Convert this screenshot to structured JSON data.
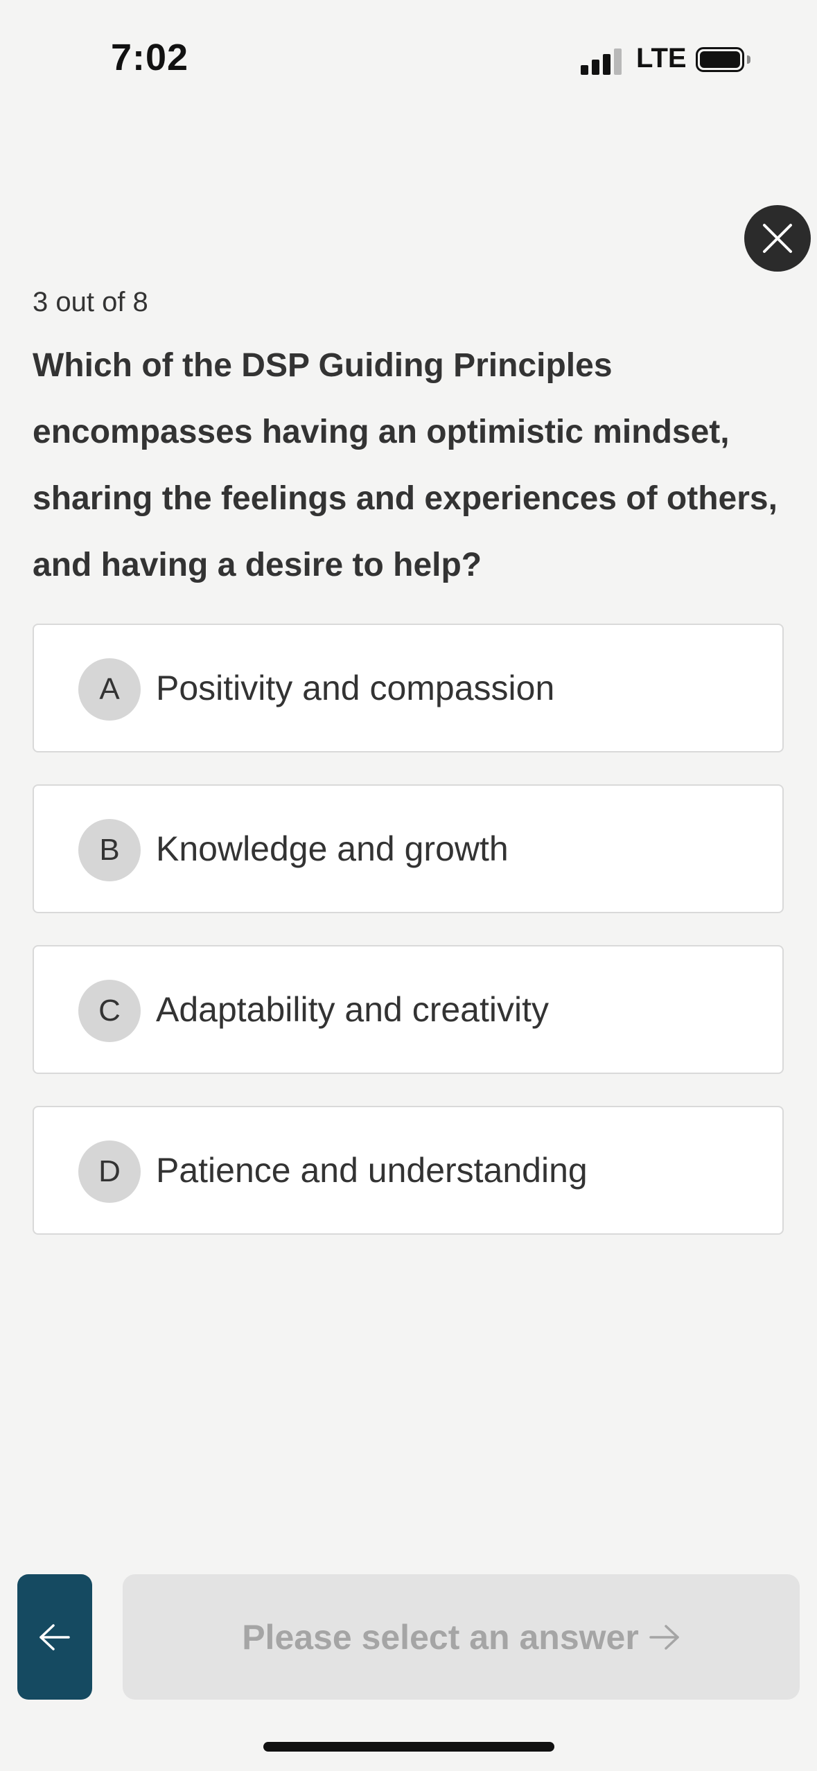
{
  "status_bar": {
    "time": "7:02",
    "network": "LTE",
    "signal_icon": "cellular-signal-icon",
    "battery_icon": "battery-icon"
  },
  "quiz": {
    "close_icon": "close-icon",
    "progress_text": "3 out of 8",
    "question": "Which of the DSP Guiding Principles encompasses having an optimistic mindset, sharing the feelings and experiences of others, and having a desire to help?",
    "options": [
      {
        "letter": "A",
        "text": "Positivity and compassion"
      },
      {
        "letter": "B",
        "text": "Knowledge and growth"
      },
      {
        "letter": "C",
        "text": "Adaptability and creativity"
      },
      {
        "letter": "D",
        "text": "Patience and understanding"
      }
    ]
  },
  "footer": {
    "back_icon": "arrow-left-icon",
    "next_label": "Please select an answer",
    "next_icon": "arrow-right-icon"
  },
  "colors": {
    "background": "#f4f4f3",
    "back_button": "#154a61",
    "next_button_disabled": "#e3e3e3",
    "close_button": "#2b2b2b"
  }
}
